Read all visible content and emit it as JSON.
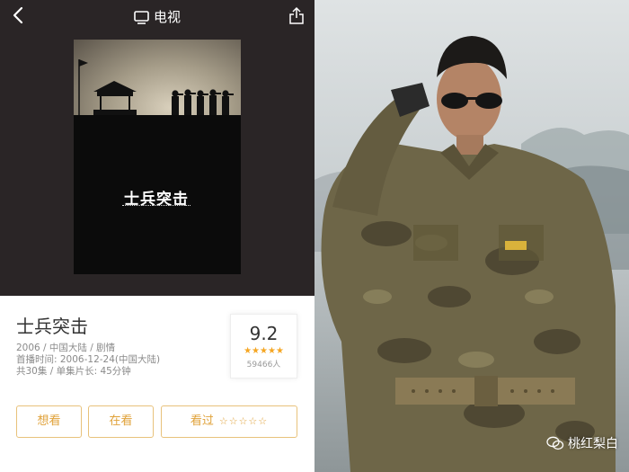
{
  "nav": {
    "title": "电视"
  },
  "poster": {
    "title_text": "士兵突击"
  },
  "show": {
    "title": "士兵突击",
    "meta_line1": "2006 / 中国大陆 / 剧情",
    "meta_line2": "首播时间:   2006-12-24(中国大陆)",
    "meta_line3": "共30集 / 单集片长:   45分钟"
  },
  "rating": {
    "score": "9.2",
    "stars": "★★★★★",
    "star_fraction": 0.92,
    "count": "59466人"
  },
  "actions": {
    "want_label": "想看",
    "watching_label": "在看",
    "watched_label": "看过",
    "watched_stars": "☆☆☆☆☆"
  },
  "watermark": {
    "text": "桃红梨白"
  },
  "colors": {
    "accent": "#e0a23a",
    "star": "#f5a623"
  }
}
